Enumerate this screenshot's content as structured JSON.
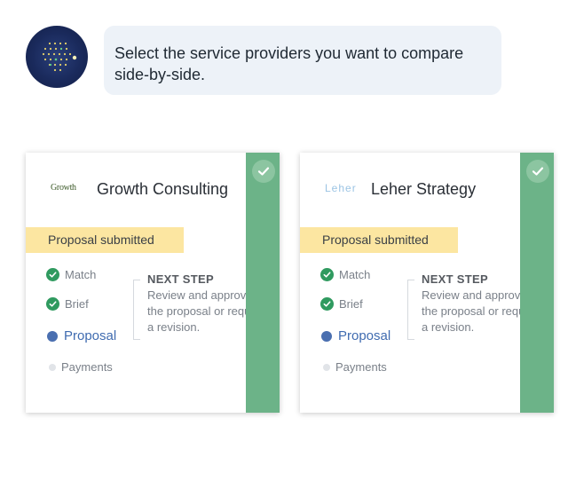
{
  "message": {
    "text": "Select the service providers you want to compare side-by-side."
  },
  "colors": {
    "selected_bar": "#6cb388",
    "status_banner": "#fce6a1",
    "step_done": "#2f9a5f",
    "step_current": "#4a6fb0"
  },
  "cards": [
    {
      "logo_text": "Growth",
      "name": "Growth Consulting",
      "selected": true,
      "status": "Proposal submitted",
      "steps": [
        {
          "label": "Match",
          "state": "done"
        },
        {
          "label": "Brief",
          "state": "done"
        },
        {
          "label": "Proposal",
          "state": "current"
        },
        {
          "label": "Payments",
          "state": "pending"
        }
      ],
      "next_step_title": "NEXT STEP",
      "next_step_text": "Review and approve the proposal or request a revision."
    },
    {
      "logo_text": "Leher",
      "name": "Leher Strategy",
      "selected": true,
      "status": "Proposal submitted",
      "steps": [
        {
          "label": "Match",
          "state": "done"
        },
        {
          "label": "Brief",
          "state": "done"
        },
        {
          "label": "Proposal",
          "state": "current"
        },
        {
          "label": "Payments",
          "state": "pending"
        }
      ],
      "next_step_title": "NEXT STEP",
      "next_step_text": "Review and approve the proposal or request a revision."
    }
  ]
}
